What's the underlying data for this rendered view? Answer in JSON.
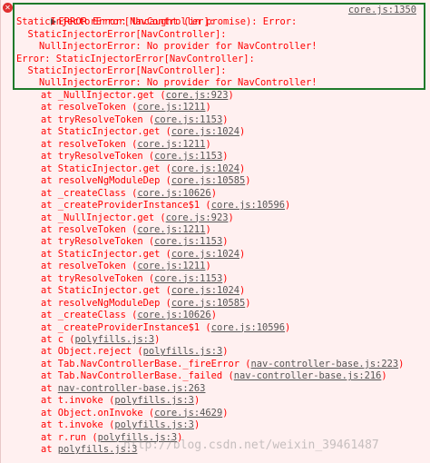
{
  "header": {
    "lines": [
      "ERROR Error: Uncaught (in promise): Error:",
      "StaticInjectorError[NavController]:",
      "  StaticInjectorError[NavController]:",
      "    NullInjectorError: No provider for NavController!",
      "Error: StaticInjectorError[NavController]:",
      "  StaticInjectorError[NavController]:",
      "    NullInjectorError: No provider for NavController!"
    ],
    "source": "core.js:1350"
  },
  "stack": [
    {
      "fn": "at _NullInjector.get ",
      "src": "core.js:923"
    },
    {
      "fn": "at resolveToken ",
      "src": "core.js:1211"
    },
    {
      "fn": "at tryResolveToken ",
      "src": "core.js:1153"
    },
    {
      "fn": "at StaticInjector.get ",
      "src": "core.js:1024"
    },
    {
      "fn": "at resolveToken ",
      "src": "core.js:1211"
    },
    {
      "fn": "at tryResolveToken ",
      "src": "core.js:1153"
    },
    {
      "fn": "at StaticInjector.get ",
      "src": "core.js:1024"
    },
    {
      "fn": "at resolveNgModuleDep ",
      "src": "core.js:10585"
    },
    {
      "fn": "at _createClass ",
      "src": "core.js:10626"
    },
    {
      "fn": "at _createProviderInstance$1 ",
      "src": "core.js:10596"
    },
    {
      "fn": "at _NullInjector.get ",
      "src": "core.js:923"
    },
    {
      "fn": "at resolveToken ",
      "src": "core.js:1211"
    },
    {
      "fn": "at tryResolveToken ",
      "src": "core.js:1153"
    },
    {
      "fn": "at StaticInjector.get ",
      "src": "core.js:1024"
    },
    {
      "fn": "at resolveToken ",
      "src": "core.js:1211"
    },
    {
      "fn": "at tryResolveToken ",
      "src": "core.js:1153"
    },
    {
      "fn": "at StaticInjector.get ",
      "src": "core.js:1024"
    },
    {
      "fn": "at resolveNgModuleDep ",
      "src": "core.js:10585"
    },
    {
      "fn": "at _createClass ",
      "src": "core.js:10626"
    },
    {
      "fn": "at _createProviderInstance$1 ",
      "src": "core.js:10596"
    },
    {
      "fn": "at c ",
      "src": "polyfills.js:3"
    },
    {
      "fn": "at Object.reject ",
      "src": "polyfills.js:3"
    },
    {
      "fn": "at Tab.NavControllerBase._fireError ",
      "src": "nav-controller-base.js:223"
    },
    {
      "fn": "at Tab.NavControllerBase._failed ",
      "src": "nav-controller-base.js:216"
    },
    {
      "fn": "at ",
      "src": "nav-controller-base.js:263",
      "bare": true
    },
    {
      "fn": "at t.invoke ",
      "src": "polyfills.js:3"
    },
    {
      "fn": "at Object.onInvoke ",
      "src": "core.js:4629"
    },
    {
      "fn": "at t.invoke ",
      "src": "polyfills.js:3"
    },
    {
      "fn": "at r.run ",
      "src": "polyfills.js:3"
    },
    {
      "fn": "at ",
      "src": "polyfills.js:3",
      "bare": true
    }
  ],
  "watermark": "http://blog.csdn.net/weixin_39461487",
  "colors": {
    "error_text": "#ff0000",
    "background": "#fff0f0",
    "highlight_border": "#1f7a2a",
    "link": "#555555"
  }
}
